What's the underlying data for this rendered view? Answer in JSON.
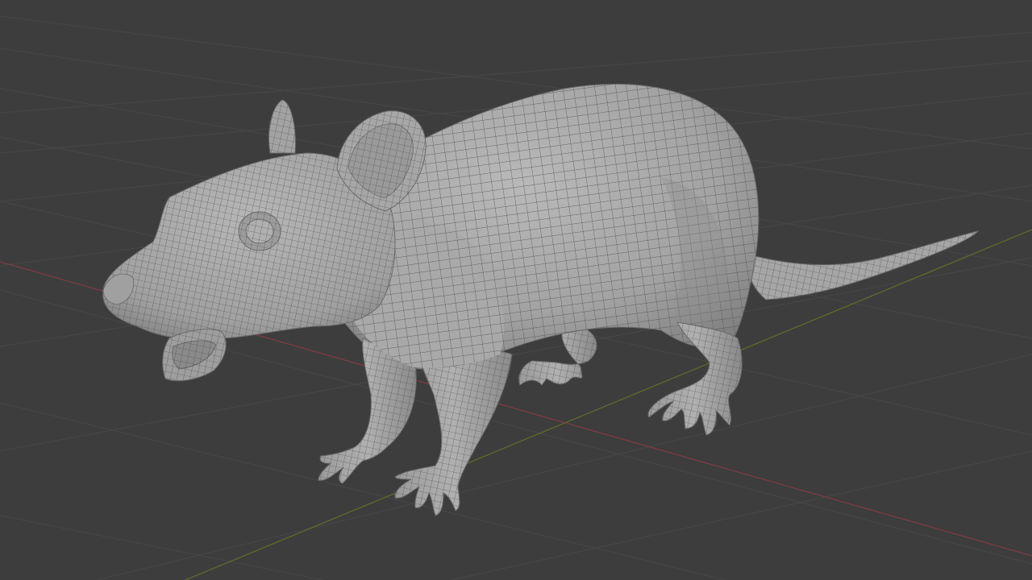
{
  "app": "3D viewport",
  "viewport": {
    "mode": "solid-shading-wireframe-overlay",
    "background_color": "#3d3d3d",
    "grid_color": "#484848",
    "x_axis_color": "#8a3a44",
    "y_axis_color": "#6b7a2e",
    "mesh_color": "#a8a8a8",
    "mesh_shadow_color": "#6e6e6e",
    "wire_color": "#4a4a4a"
  },
  "scene": {
    "object": "rat-mesh"
  }
}
